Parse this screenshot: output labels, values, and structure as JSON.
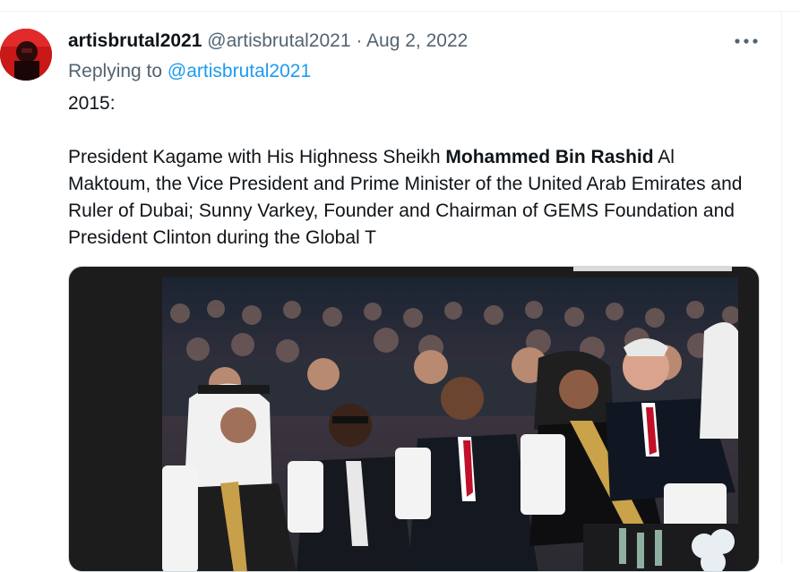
{
  "tweet": {
    "author_name": "artisbrutal2021",
    "author_handle": "@artisbrutal2021",
    "separator": "·",
    "date": "Aug 2, 2022",
    "replying_prefix": "Replying to ",
    "replying_handle": "@artisbrutal2021",
    "more_icon": "more-horizontal-icon",
    "body": {
      "line1": "2015:",
      "text_before": "President Kagame with His Highness Sheikh ",
      "text_bold": "Mohammed Bin Rashid",
      "text_after": " Al Maktoum, the Vice President and Prime Minister of the United Arab Emirates and Ruler of Dubai; Sunny Varkey, Founder and Chairman of GEMS Foundation and President Clinton during the Global T"
    },
    "media": {
      "type": "photo"
    }
  },
  "colors": {
    "text_primary": "#0f1419",
    "text_secondary": "#536471",
    "link": "#1d9bf0",
    "avatar_bg": "#c81818",
    "media_bg": "#1c1c1c"
  }
}
